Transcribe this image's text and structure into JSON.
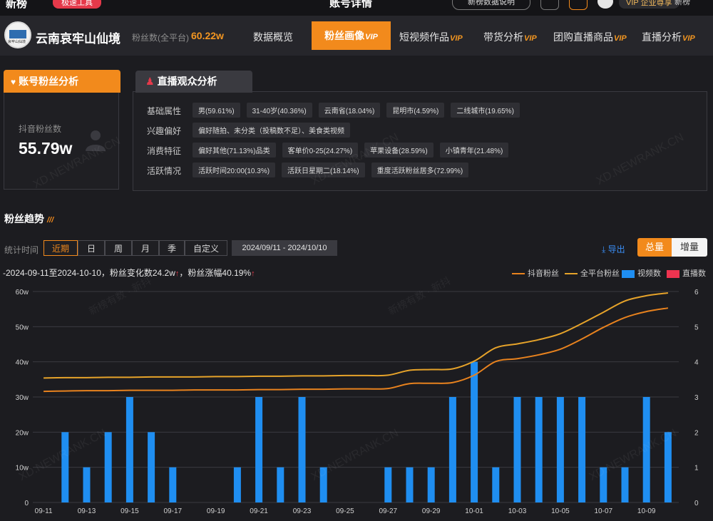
{
  "topbar": {
    "logo": "新榜",
    "badge": "极速工具",
    "title": "账号详情",
    "button": "新榜数据说明",
    "vip": "VIP 企业尊享",
    "new_label": "新榜"
  },
  "account": {
    "logo_text": "哀牢山仙境",
    "name": "云南哀牢山仙境",
    "fans_label": "粉丝数(全平台)",
    "fans_value": "60.22w"
  },
  "nav": [
    {
      "label": "数据概览",
      "vip": ""
    },
    {
      "label": "粉丝画像",
      "vip": "VIP"
    },
    {
      "label": "短视频作品",
      "vip": "VIP"
    },
    {
      "label": "带货分析",
      "vip": "VIP"
    },
    {
      "label": "团购直播商品",
      "vip": "VIP"
    },
    {
      "label": "直播分析",
      "vip": "VIP"
    }
  ],
  "fan_panel": {
    "tab": "账号粉丝分析",
    "label": "抖音粉丝数",
    "value": "55.79w"
  },
  "audience": {
    "tab": "直播观众分析",
    "rows": [
      {
        "label": "基础属性",
        "tags": [
          "男(59.61%)",
          "31-40岁(40.36%)",
          "云南省(18.04%)",
          "昆明市(4.59%)",
          "二线城市(19.65%)"
        ]
      },
      {
        "label": "兴趣偏好",
        "tags": [
          "偏好随拍、未分类（投稿数不足）、美食类视频"
        ]
      },
      {
        "label": "消费特征",
        "tags": [
          "偏好其他(71.13%)品类",
          "客单价0-25(24.27%)",
          "苹果设备(28.59%)",
          "小镇青年(21.48%)"
        ]
      },
      {
        "label": "活跃情况",
        "tags": [
          "活跃时间20:00(10.3%)",
          "活跃日星期二(18.14%)",
          "重度活跃粉丝居多(72.99%)"
        ]
      }
    ]
  },
  "trend": {
    "title": "粉丝趋势",
    "period_label": "统计时间",
    "periods": [
      "近期",
      "日",
      "周",
      "月",
      "季",
      "自定义"
    ],
    "date_range": "2024/09/11  -  2024/10/10",
    "export": "导出",
    "total_btn": "总量",
    "inc_btn": "增量",
    "summary": "-2024-09-11至2024-10-10，粉丝变化数24.2w",
    "summary_rate": "，粉丝涨幅40.19%"
  },
  "colors": {
    "douyin_line": "#e8821e",
    "all_line": "#e6a32a",
    "video_bar": "#1f8ef1",
    "live_bar": "#ee3450",
    "accent": "#f28a1c"
  },
  "watermark": "XD.NEWRANK.CN",
  "watermark2": "新榜有数 · 新抖",
  "chart_data": {
    "type": "line+bar",
    "legend": [
      "抖音粉丝",
      "全平台粉丝",
      "视频数",
      "直播数"
    ],
    "y_left_ticks": [
      "0",
      "10w",
      "20w",
      "30w",
      "40w",
      "50w",
      "60w"
    ],
    "y_left_range": [
      0,
      60
    ],
    "y_right_ticks": [
      "0",
      "1",
      "2",
      "3",
      "4",
      "5",
      "6"
    ],
    "y_right_range": [
      0,
      6
    ],
    "x_tick_labels": [
      "09-11",
      "09-13",
      "09-15",
      "09-17",
      "09-19",
      "09-21",
      "09-23",
      "09-25",
      "09-27",
      "09-29",
      "10-01",
      "10-03",
      "10-05",
      "10-07",
      "10-09"
    ],
    "x": [
      "09-11",
      "09-12",
      "09-13",
      "09-14",
      "09-15",
      "09-16",
      "09-17",
      "09-18",
      "09-19",
      "09-20",
      "09-21",
      "09-22",
      "09-23",
      "09-24",
      "09-25",
      "09-26",
      "09-27",
      "09-28",
      "09-29",
      "09-30",
      "10-01",
      "10-02",
      "10-03",
      "10-04",
      "10-05",
      "10-06",
      "10-07",
      "10-08",
      "10-09",
      "10-10"
    ],
    "series": [
      {
        "name": "抖音粉丝",
        "axis": "left",
        "type": "line",
        "values": [
          31.6,
          31.7,
          31.8,
          31.8,
          31.9,
          31.9,
          31.9,
          32.0,
          32.0,
          32.0,
          32.1,
          32.1,
          32.2,
          32.2,
          32.3,
          32.3,
          32.4,
          33.8,
          33.9,
          34.1,
          36.2,
          40.1,
          40.9,
          42.0,
          43.6,
          46.5,
          49.8,
          52.6,
          54.3,
          55.3
        ]
      },
      {
        "name": "全平台粉丝",
        "axis": "left",
        "type": "line",
        "values": [
          35.4,
          35.5,
          35.5,
          35.6,
          35.6,
          35.7,
          35.7,
          35.7,
          35.8,
          35.8,
          35.9,
          35.9,
          36.0,
          36.0,
          36.1,
          36.1,
          36.2,
          37.6,
          37.8,
          38.0,
          40.2,
          44.0,
          45.1,
          46.3,
          48.0,
          50.9,
          54.1,
          57.3,
          58.8,
          59.6
        ]
      },
      {
        "name": "视频数",
        "axis": "right",
        "type": "bar",
        "values": [
          0,
          2,
          1,
          2,
          3,
          2,
          1,
          0,
          0,
          1,
          3,
          1,
          3,
          1,
          0,
          0,
          1,
          1,
          1,
          3,
          4,
          1,
          3,
          3,
          3,
          3,
          1,
          1,
          3,
          2
        ]
      },
      {
        "name": "直播数",
        "axis": "right",
        "type": "bar",
        "values": [
          0,
          0,
          0,
          0,
          0,
          0,
          0,
          0,
          0,
          0,
          0,
          0,
          0,
          0,
          0,
          0,
          0,
          0,
          0,
          0,
          0,
          0,
          0,
          0,
          0,
          0,
          0,
          0,
          0,
          0
        ]
      }
    ]
  }
}
